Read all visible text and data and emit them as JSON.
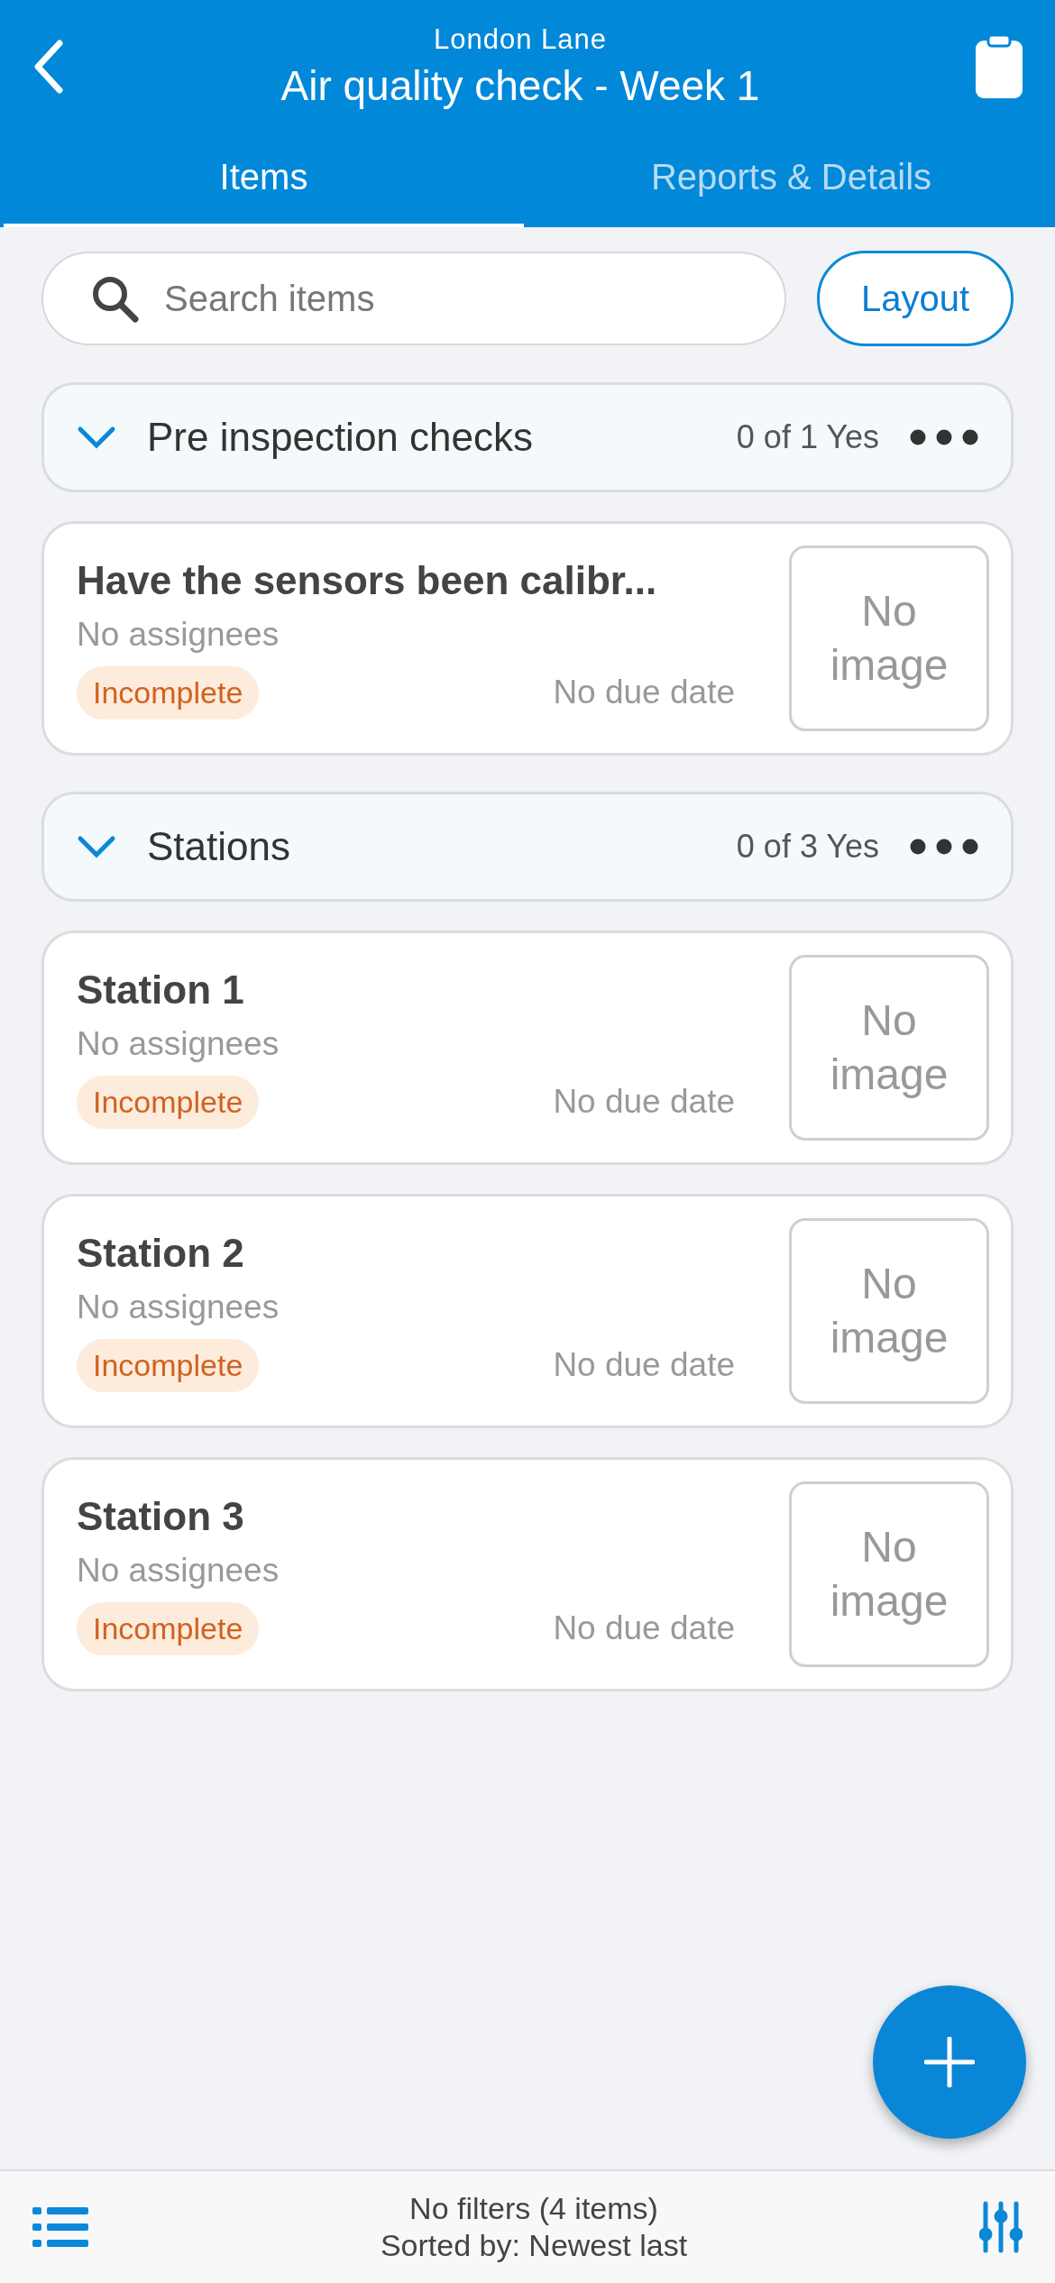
{
  "header": {
    "subtitle": "London Lane",
    "title": "Air quality check - Week 1"
  },
  "tabs": [
    {
      "label": "Items",
      "selected": true
    },
    {
      "label": "Reports & Details",
      "selected": false
    }
  ],
  "search": {
    "placeholder": "Search items"
  },
  "layout_button": "Layout",
  "sections": [
    {
      "title": "Pre inspection checks",
      "summary": "0 of 1 Yes",
      "expanded": true,
      "items": [
        {
          "title": "Have the sensors been calibr...",
          "assignees": "No assignees",
          "status": "Incomplete",
          "due": "No due date",
          "image": "No image"
        }
      ]
    },
    {
      "title": "Stations",
      "summary": "0 of 3 Yes",
      "expanded": true,
      "items": [
        {
          "title": "Station 1",
          "assignees": "No assignees",
          "status": "Incomplete",
          "due": "No due date",
          "image": "No image"
        },
        {
          "title": "Station 2",
          "assignees": "No assignees",
          "status": "Incomplete",
          "due": "No due date",
          "image": "No image"
        },
        {
          "title": "Station 3",
          "assignees": "No assignees",
          "status": "Incomplete",
          "due": "No due date",
          "image": "No image"
        }
      ]
    }
  ],
  "footer": {
    "filters": "No filters (4 items)",
    "sort": "Sorted by: Newest last"
  }
}
